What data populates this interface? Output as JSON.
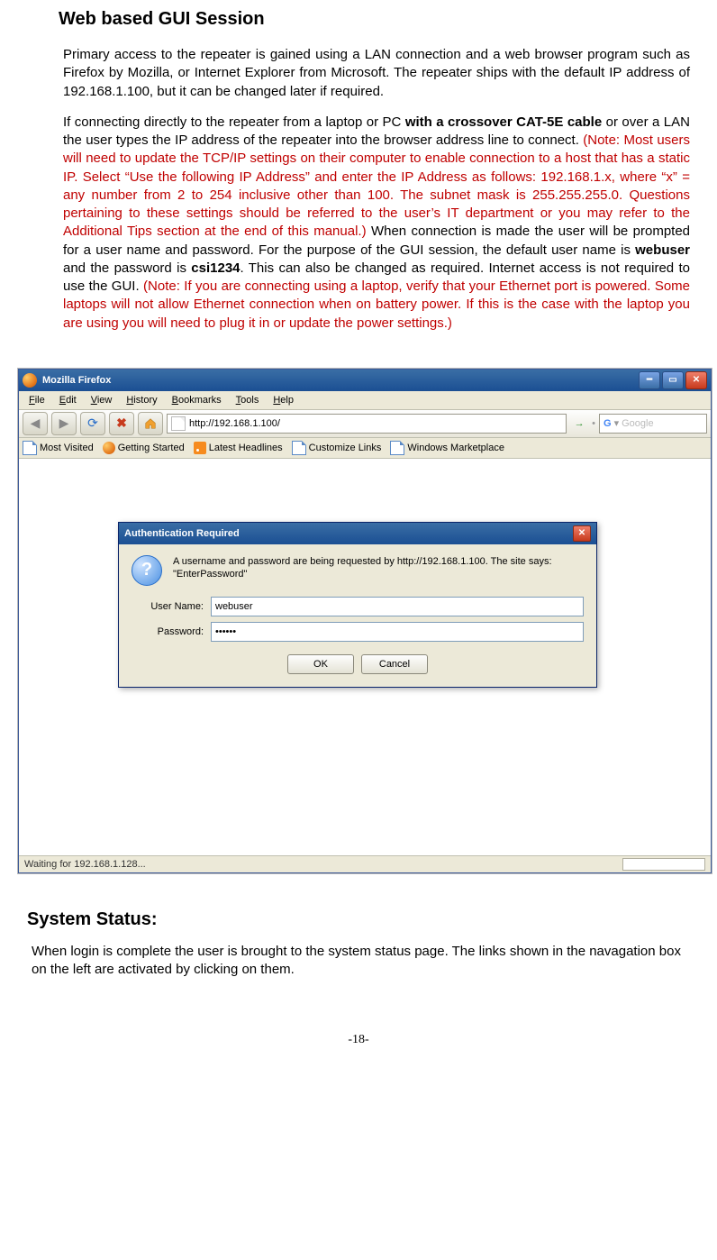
{
  "heading": "Web based GUI Session",
  "para1_a": "Primary access to the repeater is  gained using a LAN connection and a web browser program such as Firefox by Mozilla, or Internet Explorer from Microsoft.  The repeater ships with the default IP address of 192.168.1.100, but it can be changed later if required.",
  "para2_a": "If connecting directly to the repeater from a laptop or PC ",
  "para2_bold1": "with a crossover CAT-5E cable",
  "para2_b": " or over a LAN the user types the IP address of the repeater into the browser address line to connect. ",
  "para2_red1": "(Note: Most users will need to update the TCP/IP settings on their computer to enable connection to a host that has a static IP.  Select “Use the following IP Address” and enter the IP Address as follows: 192.168.1.x, where “x” = any number from 2 to 254 inclusive other than 100. The subnet mask is 255.255.255.0.  Questions pertaining to these settings should be referred to the user’s IT department or you may refer to the Additional Tips section at the end of this manual.)",
  "para2_c": "  When connection is made the user will be prompted for a user name and password. For the purpose of the GUI session, the default user name is ",
  "para2_bold2": "webuser",
  "para2_d": " and the password is ",
  "para2_bold3": "csi1234",
  "para2_e": ".  This can also be changed as required. Internet access is not required to use the GUI.  ",
  "para2_red2": "(Note: If you are connecting using a laptop, verify that your Ethernet port is powered.  Some laptops will not allow Ethernet connection when on battery power. If this is the case with the laptop you are using you will need to plug it in or update the power settings.)",
  "browser": {
    "title": "Mozilla Firefox",
    "menu": [
      "File",
      "Edit",
      "View",
      "History",
      "Bookmarks",
      "Tools",
      "Help"
    ],
    "url": "http://192.168.1.100/",
    "search_placeholder": "Google",
    "bookmarks": [
      "Most Visited",
      "Getting Started",
      "Latest Headlines",
      "Customize Links",
      "Windows Marketplace"
    ],
    "status": "Waiting for 192.168.1.128..."
  },
  "dialog": {
    "title": "Authentication Required",
    "message": "A username and password are being requested by http://192.168.1.100. The site says: \"EnterPassword\"",
    "user_label": "User Name:",
    "pass_label": "Password:",
    "user_value": "webuser",
    "pass_value": "••••••",
    "ok": "OK",
    "cancel": "Cancel"
  },
  "heading2": "System Status:",
  "para3": "When login is complete the user is brought to the system status page. The links shown in the navagation box on the left are activated by clicking on them.",
  "page_number": "-18-"
}
